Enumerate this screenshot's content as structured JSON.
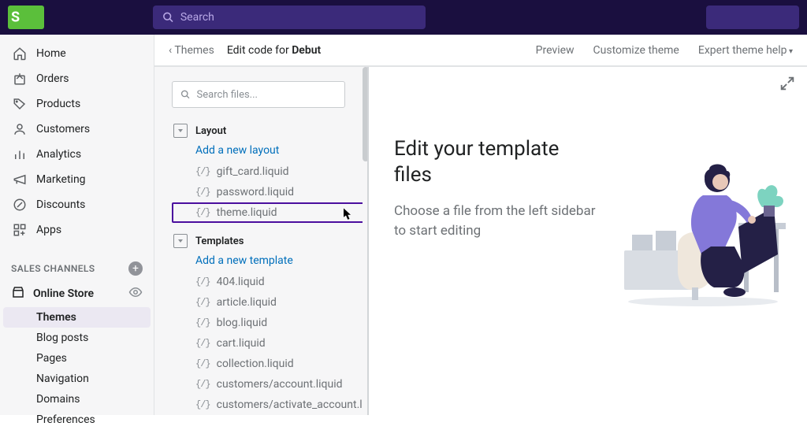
{
  "topbar": {
    "search_placeholder": "Search"
  },
  "sidebar": {
    "items": [
      {
        "name": "home",
        "label": "Home"
      },
      {
        "name": "orders",
        "label": "Orders"
      },
      {
        "name": "products",
        "label": "Products"
      },
      {
        "name": "customers",
        "label": "Customers"
      },
      {
        "name": "analytics",
        "label": "Analytics"
      },
      {
        "name": "marketing",
        "label": "Marketing"
      },
      {
        "name": "discounts",
        "label": "Discounts"
      },
      {
        "name": "apps",
        "label": "Apps"
      }
    ],
    "sales_channels_header": "SALES CHANNELS",
    "online_store_label": "Online Store",
    "sub_items": [
      {
        "name": "themes",
        "label": "Themes",
        "active": true
      },
      {
        "name": "blog-posts",
        "label": "Blog posts"
      },
      {
        "name": "pages",
        "label": "Pages"
      },
      {
        "name": "navigation",
        "label": "Navigation"
      },
      {
        "name": "domains",
        "label": "Domains"
      },
      {
        "name": "preferences",
        "label": "Preferences"
      }
    ]
  },
  "crumb": {
    "back": "Themes",
    "title_prefix": "Edit code for ",
    "title_bold": "Debut",
    "actions": [
      {
        "name": "preview",
        "label": "Preview"
      },
      {
        "name": "customize",
        "label": "Customize theme"
      },
      {
        "name": "expert-help",
        "label": "Expert theme help",
        "dropdown": true
      }
    ]
  },
  "files": {
    "search_placeholder": "Search files...",
    "folders": [
      {
        "name": "layout",
        "label": "Layout",
        "add_label": "Add a new layout",
        "files": [
          {
            "name": "gift_card.liquid"
          },
          {
            "name": "password.liquid"
          },
          {
            "name": "theme.liquid",
            "highlighted": true
          }
        ]
      },
      {
        "name": "templates",
        "label": "Templates",
        "add_label": "Add a new template",
        "files": [
          {
            "name": "404.liquid"
          },
          {
            "name": "article.liquid"
          },
          {
            "name": "blog.liquid"
          },
          {
            "name": "cart.liquid"
          },
          {
            "name": "collection.liquid"
          },
          {
            "name": "customers/account.liquid"
          },
          {
            "name": "customers/activate_account.liquid"
          }
        ]
      }
    ]
  },
  "editor": {
    "hero_title": "Edit your template files",
    "hero_sub": "Choose a file from the left sidebar to start editing"
  }
}
